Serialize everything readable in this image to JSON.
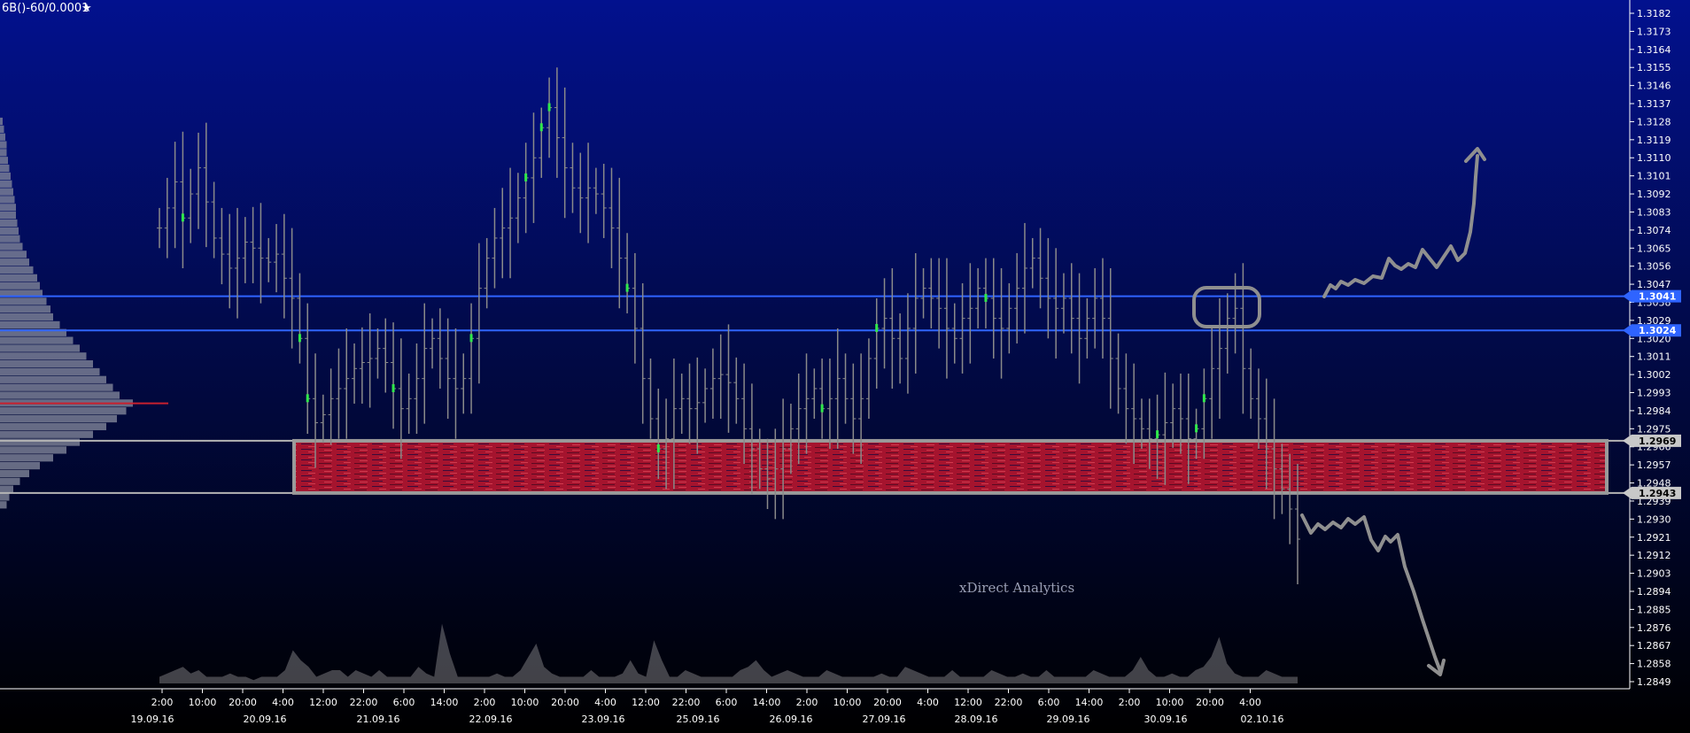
{
  "header": {
    "symbol": "6B()-60/0.0001",
    "star_icon": "star-icon"
  },
  "watermark": "xDirect Analytics",
  "colors": {
    "bg_top": "#02118e",
    "bg_bottom": "#000000",
    "candle": "#8a8a8a",
    "highlight": "#2fe84a",
    "level_line": "#2f64ff",
    "badge_blue": "#2f64ff",
    "zone_fill": "#a5142e",
    "zone_border": "#b4b4b4",
    "badge_grey": "#c8c8c8",
    "volume": "#bdbdbd",
    "drawing": "#8f8f8f"
  },
  "chart_data": {
    "type": "candlestick",
    "title": "6B()-60/0.0001",
    "ylim": [
      1.2849,
      1.3182
    ],
    "grid": false,
    "y_ticks": [
      "1.3182",
      "1.3173",
      "1.3164",
      "1.3155",
      "1.3146",
      "1.3137",
      "1.3128",
      "1.3119",
      "1.3110",
      "1.3101",
      "1.3092",
      "1.3083",
      "1.3074",
      "1.3065",
      "1.3056",
      "1.3047",
      "1.3038",
      "1.3029",
      "1.3020",
      "1.3011",
      "1.3002",
      "1.2993",
      "1.2984",
      "1.2975",
      "1.2966",
      "1.2957",
      "1.2948",
      "1.2939",
      "1.2930",
      "1.2921",
      "1.2912",
      "1.2903",
      "1.2894",
      "1.2885",
      "1.2876",
      "1.2867",
      "1.2858",
      "1.2849"
    ],
    "time_labels": [
      "2:00",
      "10:00",
      "20:00",
      "4:00",
      "12:00",
      "22:00",
      "6:00",
      "14:00",
      "2:00",
      "10:00",
      "20:00",
      "4:00",
      "12:00",
      "22:00",
      "6:00",
      "14:00",
      "2:00",
      "10:00",
      "20:00",
      "4:00",
      "12:00",
      "22:00",
      "6:00",
      "14:00",
      "2:00",
      "10:00",
      "20:00",
      "4:00"
    ],
    "date_labels": [
      "19.09.16",
      "20.09.16",
      "21.09.16",
      "22.09.16",
      "23.09.16",
      "25.09.16",
      "26.09.16",
      "27.09.16",
      "28.09.16",
      "29.09.16",
      "30.09.16",
      "02.10.16"
    ],
    "price_levels": [
      {
        "label": "1.3041",
        "value": 1.3041,
        "style": "blue"
      },
      {
        "label": "1.3024",
        "value": 1.3024,
        "style": "blue"
      },
      {
        "label": "1.2969",
        "value": 1.2969,
        "style": "grey"
      },
      {
        "label": "1.2943",
        "value": 1.2943,
        "style": "grey"
      }
    ],
    "zone": {
      "high": 1.2969,
      "low": 1.2943
    },
    "price_path": [
      1.3075,
      1.3085,
      1.3098,
      1.308,
      1.3092,
      1.3105,
      1.3088,
      1.307,
      1.3062,
      1.3055,
      1.306,
      1.3068,
      1.3065,
      1.306,
      1.3058,
      1.3062,
      1.305,
      1.304,
      1.302,
      1.299,
      1.2978,
      1.2982,
      1.299,
      1.2995,
      1.3,
      1.3005,
      1.3008,
      1.301,
      1.3015,
      1.3008,
      1.2995,
      1.2985,
      1.299,
      1.3,
      1.3015,
      1.302,
      1.301,
      1.3,
      1.2995,
      1.3,
      1.302,
      1.3045,
      1.306,
      1.307,
      1.3075,
      1.308,
      1.309,
      1.31,
      1.311,
      1.3125,
      1.3135,
      1.312,
      1.3105,
      1.3095,
      1.309,
      1.3095,
      1.3092,
      1.3085,
      1.3075,
      1.306,
      1.3045,
      1.3025,
      1.3,
      1.298,
      1.2965,
      1.297,
      1.2985,
      1.299,
      1.2985,
      1.2988,
      1.2995,
      1.3,
      1.3002,
      1.2998,
      1.299,
      1.2975,
      1.2965,
      1.2955,
      1.295,
      1.2955,
      1.2965,
      1.2975,
      1.2985,
      1.299,
      1.2995,
      1.2985,
      1.299,
      1.3,
      1.299,
      1.298,
      1.299,
      1.301,
      1.3025,
      1.303,
      1.302,
      1.301,
      1.3025,
      1.304,
      1.3045,
      1.304,
      1.3035,
      1.3025,
      1.302,
      1.303,
      1.3035,
      1.3045,
      1.304,
      1.303,
      1.3025,
      1.3035,
      1.3045,
      1.3055,
      1.306,
      1.305,
      1.304,
      1.3035,
      1.304,
      1.303,
      1.302,
      1.303,
      1.304,
      1.303,
      1.301,
      1.2995,
      1.2985,
      1.298,
      1.2975,
      1.297,
      1.2972,
      1.2978,
      1.2985,
      1.298,
      1.297,
      1.2975,
      1.299,
      1.3005,
      1.3015,
      1.303,
      1.3035,
      1.3005,
      1.299,
      1.298,
      1.2965,
      1.2955,
      1.2945,
      1.2935,
      1.292
    ],
    "highlights": [
      3,
      18,
      19,
      30,
      40,
      47,
      49,
      50,
      60,
      64,
      85,
      92,
      106,
      128,
      133,
      134
    ],
    "volume": [
      0.1,
      0.15,
      0.2,
      0.25,
      0.15,
      0.2,
      0.1,
      0.1,
      0.1,
      0.15,
      0.1,
      0.1,
      0.05,
      0.1,
      0.1,
      0.1,
      0.2,
      0.5,
      0.35,
      0.25,
      0.1,
      0.15,
      0.2,
      0.2,
      0.1,
      0.2,
      0.15,
      0.1,
      0.2,
      0.1,
      0.1,
      0.1,
      0.1,
      0.25,
      0.15,
      0.1,
      0.9,
      0.45,
      0.1,
      0.1,
      0.1,
      0.1,
      0.1,
      0.15,
      0.1,
      0.1,
      0.2,
      0.4,
      0.6,
      0.25,
      0.15,
      0.1,
      0.1,
      0.1,
      0.1,
      0.2,
      0.1,
      0.1,
      0.1,
      0.15,
      0.35,
      0.15,
      0.1,
      0.65,
      0.35,
      0.1,
      0.1,
      0.2,
      0.15,
      0.1,
      0.1,
      0.1,
      0.1,
      0.1,
      0.2,
      0.25,
      0.35,
      0.2,
      0.1,
      0.15,
      0.2,
      0.15,
      0.1,
      0.1,
      0.1,
      0.2,
      0.15,
      0.1,
      0.1,
      0.1,
      0.1,
      0.1,
      0.15,
      0.1,
      0.1,
      0.25,
      0.2,
      0.15,
      0.1,
      0.1,
      0.1,
      0.2,
      0.1,
      0.1,
      0.1,
      0.1,
      0.2,
      0.15,
      0.1,
      0.1,
      0.15,
      0.1,
      0.1,
      0.2,
      0.1,
      0.1,
      0.1,
      0.1,
      0.1,
      0.2,
      0.15,
      0.1,
      0.1,
      0.1,
      0.2,
      0.4,
      0.2,
      0.1,
      0.1,
      0.15,
      0.1,
      0.1,
      0.2,
      0.25,
      0.4,
      0.7,
      0.3,
      0.15,
      0.1,
      0.1,
      0.1,
      0.2,
      0.15,
      0.1,
      0.1,
      0.1
    ],
    "profile": [
      0.02,
      0.03,
      0.04,
      0.05,
      0.05,
      0.06,
      0.07,
      0.08,
      0.09,
      0.1,
      0.11,
      0.12,
      0.12,
      0.13,
      0.14,
      0.15,
      0.17,
      0.2,
      0.22,
      0.25,
      0.28,
      0.3,
      0.32,
      0.35,
      0.38,
      0.4,
      0.45,
      0.5,
      0.55,
      0.6,
      0.65,
      0.7,
      0.75,
      0.8,
      0.85,
      0.9,
      1.0,
      0.95,
      0.88,
      0.8,
      0.7,
      0.6,
      0.5,
      0.4,
      0.3,
      0.22,
      0.15,
      0.1,
      0.07,
      0.05
    ]
  }
}
